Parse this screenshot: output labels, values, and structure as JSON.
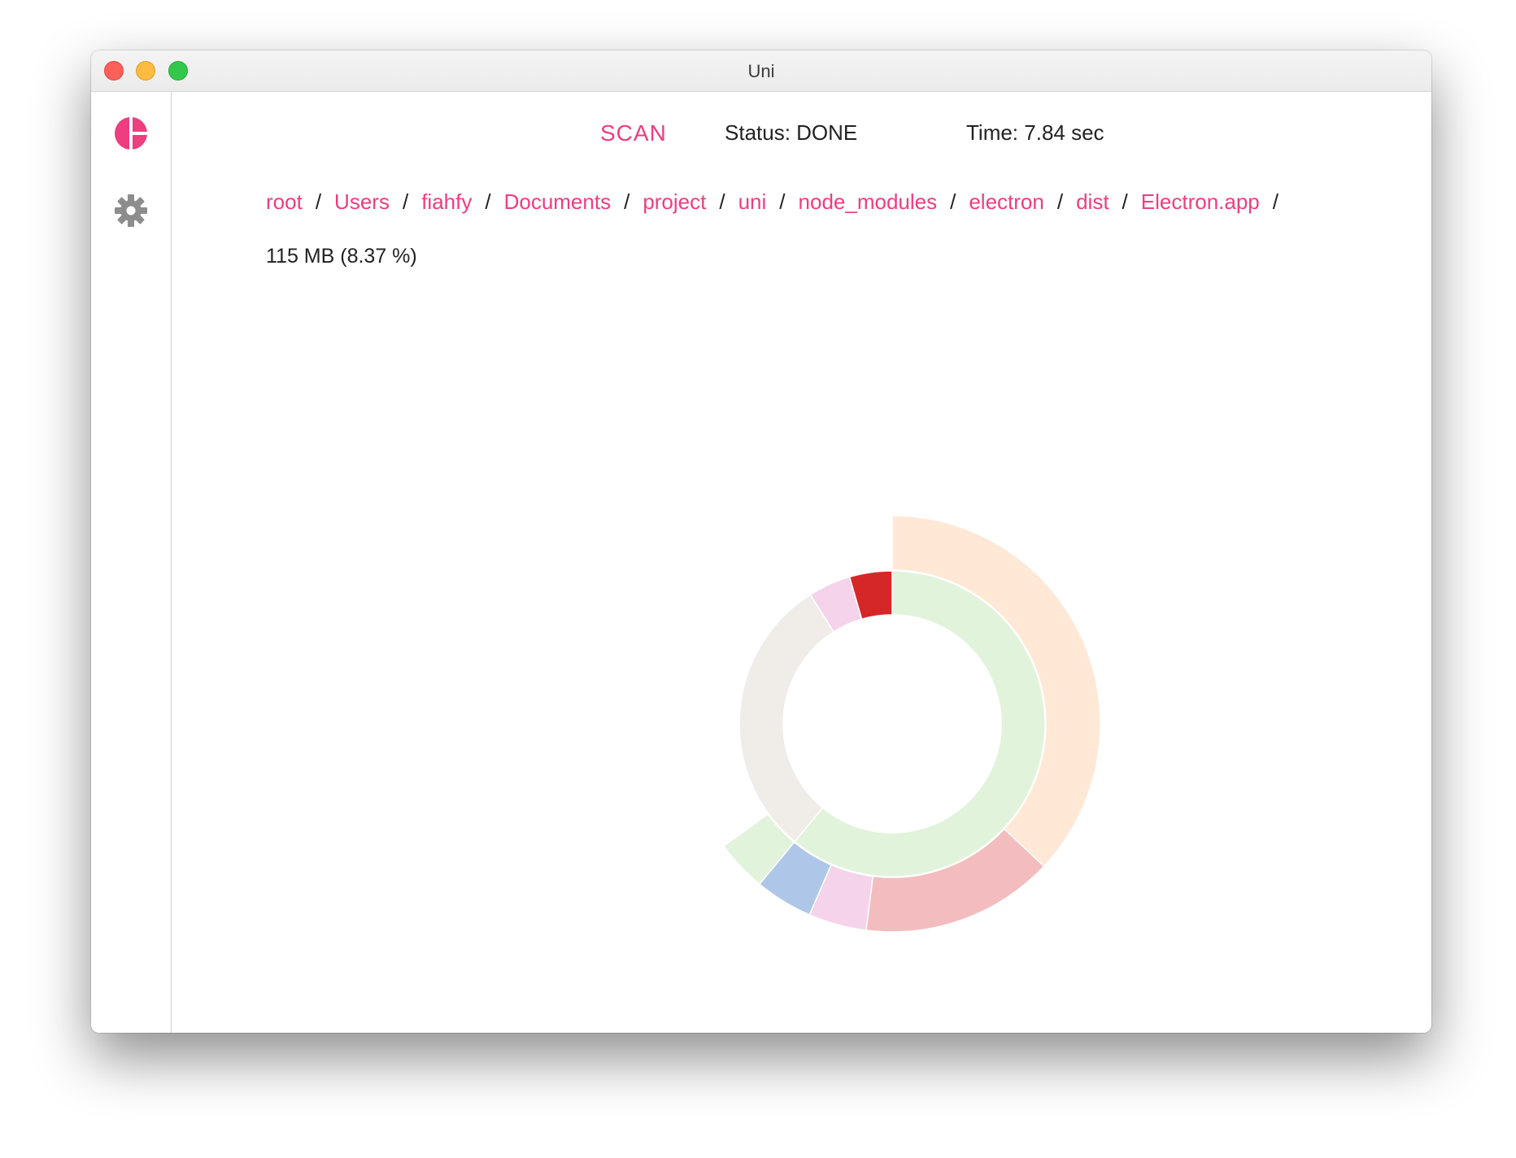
{
  "window": {
    "title": "Uni"
  },
  "sidebar": {
    "logo_icon": "pie-logo-icon",
    "settings_icon": "gear-icon",
    "accent": "#ee3d80"
  },
  "header": {
    "scan_label": "SCAN",
    "status_text": "Status: DONE",
    "time_text": "Time: 7.84 sec"
  },
  "breadcrumb": {
    "items": [
      "root",
      "Users",
      "fiahfy",
      "Documents",
      "project",
      "uni",
      "node_modules",
      "electron",
      "dist",
      "Electron.app"
    ],
    "separator": "/"
  },
  "selection": {
    "size_text": "115 MB (8.37 %)"
  },
  "chart_data": {
    "type": "sunburst",
    "rings": [
      {
        "segments": [
          {
            "share": 0.61,
            "color": "#e2f3db"
          },
          {
            "share": 0.3,
            "color": "#f0ece8"
          },
          {
            "share": 0.045,
            "color": "#f5d3ea"
          },
          {
            "share": 0.045,
            "color": "#d62728"
          }
        ]
      },
      {
        "segments": [
          {
            "share": 0.37,
            "color": "#ffe8d6"
          },
          {
            "share": 0.15,
            "color": "#f3bdbf"
          },
          {
            "share": 0.045,
            "color": "#f5d3ea"
          },
          {
            "share": 0.045,
            "color": "#aec7e8"
          },
          {
            "share": 0.04,
            "color": "#e2f3db"
          }
        ]
      }
    ]
  }
}
